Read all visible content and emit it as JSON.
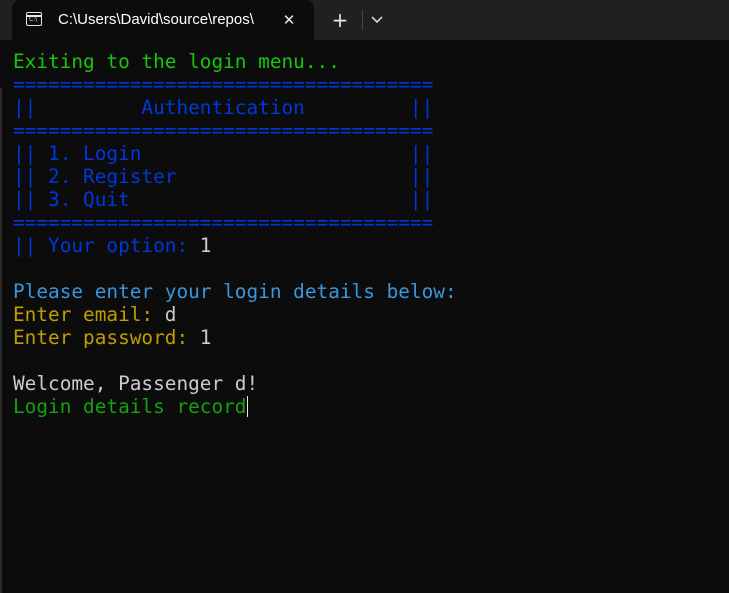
{
  "window": {
    "tab_title": "C:\\Users\\David\\source\\repos\\",
    "tab_icon": "terminal-icon",
    "close_symbol": "✕",
    "new_tab_symbol": "+",
    "dropdown_icon": "chevron-down-icon"
  },
  "terminal": {
    "exiting": "Exiting to the login menu...",
    "border": "====================================",
    "auth_title": "||         Authentication         ||",
    "option_login": "|| 1. Login                       ||",
    "option_register": "|| 2. Register                    ||",
    "option_quit": "|| 3. Quit                        ||",
    "option_prompt": "|| Your option: ",
    "option_value": "1",
    "login_prompt": "Please enter your login details below:",
    "email_label": "Enter email: ",
    "email_value": "d",
    "password_label": "Enter password: ",
    "password_value": "1",
    "welcome": "Welcome, Passenger d!",
    "record": "Login details record"
  },
  "colors": {
    "background": "#0c0c0c",
    "green": "#16c60c",
    "blue": "#0037da",
    "cyan": "#3a96dd",
    "gold": "#c19c00",
    "white": "#cccccc"
  }
}
